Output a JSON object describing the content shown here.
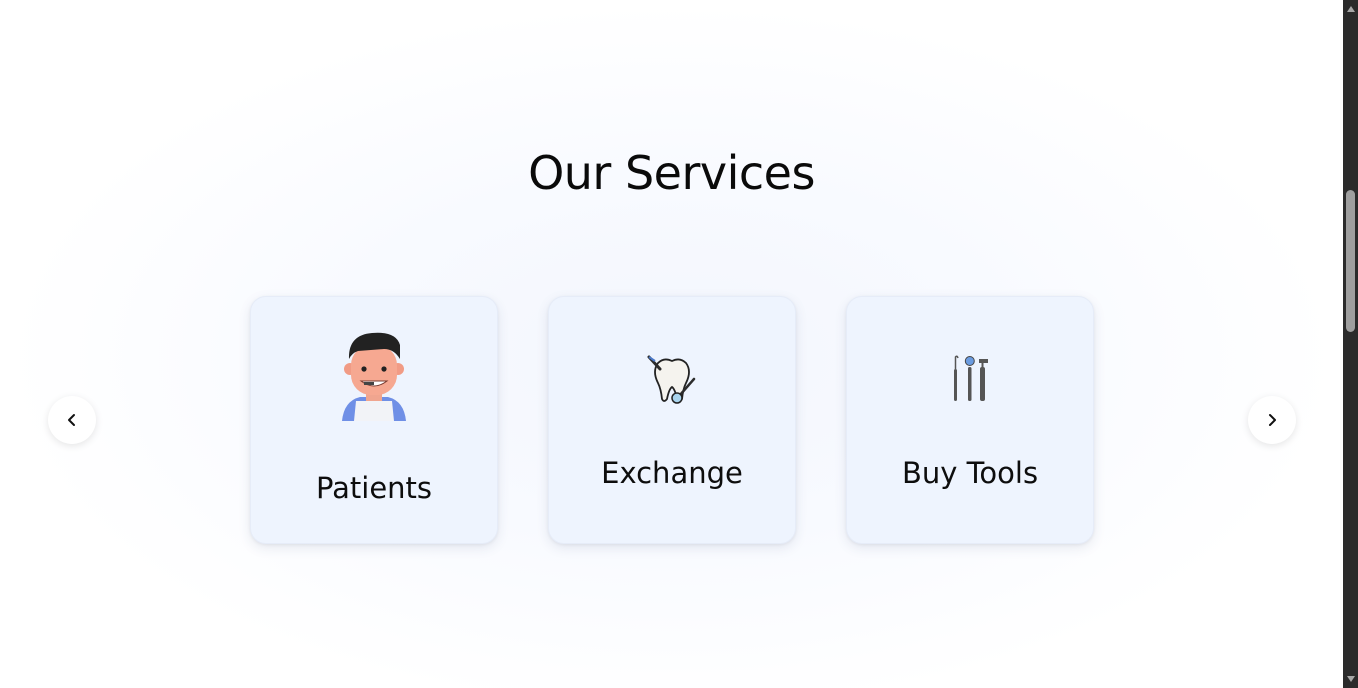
{
  "section": {
    "title": "Our Services"
  },
  "services": [
    {
      "label": "Patients",
      "icon": "dentist-avatar-icon"
    },
    {
      "label": "Exchange",
      "icon": "tooth-icon"
    },
    {
      "label": "Buy Tools",
      "icon": "dental-tools-icon"
    }
  ],
  "carousel": {
    "prev_icon": "chevron-left-icon",
    "next_icon": "chevron-right-icon"
  },
  "colors": {
    "card_bg": "#eef4fe",
    "text": "#0d0d0d",
    "scrollbar_track": "#2b2b2b",
    "scrollbar_thumb": "#9f9f9f"
  }
}
